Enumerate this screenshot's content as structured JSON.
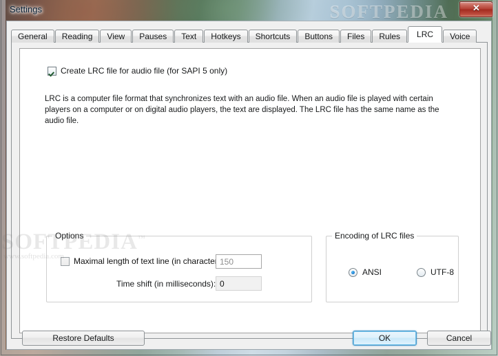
{
  "window": {
    "title": "Settings",
    "close_label": "✕",
    "close_icon": "close-icon"
  },
  "watermark": {
    "titlebar": "SOFTPEDIA",
    "body_main": "SOFTPEDIA",
    "body_tm": "™",
    "body_sub": "www.softpedia.com"
  },
  "tabs": [
    {
      "label": "General",
      "selected": false
    },
    {
      "label": "Reading",
      "selected": false
    },
    {
      "label": "View",
      "selected": false
    },
    {
      "label": "Pauses",
      "selected": false
    },
    {
      "label": "Text",
      "selected": false
    },
    {
      "label": "Hotkeys",
      "selected": false
    },
    {
      "label": "Shortcuts",
      "selected": false
    },
    {
      "label": "Buttons",
      "selected": false
    },
    {
      "label": "Files",
      "selected": false
    },
    {
      "label": "Rules",
      "selected": false
    },
    {
      "label": "LRC",
      "selected": true
    },
    {
      "label": "Voice",
      "selected": false
    }
  ],
  "lrc_page": {
    "create_lrc": {
      "label": "Create LRC file for audio file (for SAPI 5 only)",
      "checked": true
    },
    "description": "LRC is a computer file format that synchronizes text with an audio file. When an audio file is played with certain players on a computer or on digital audio players, the text are displayed. The LRC file has the same name as the audio file.",
    "options_group": {
      "title": "Options",
      "max_length": {
        "label": "Maximal length of text line (in characters):",
        "checked": false,
        "enabled": false,
        "value": "150"
      },
      "time_shift": {
        "label": "Time shift (in milliseconds):",
        "value": "0"
      }
    },
    "encoding_group": {
      "title": "Encoding of LRC files",
      "options": [
        {
          "label": "ANSI",
          "selected": true
        },
        {
          "label": "UTF-8",
          "selected": false
        }
      ]
    }
  },
  "footer": {
    "restore_defaults": "Restore Defaults",
    "ok": "OK",
    "cancel": "Cancel"
  },
  "colors": {
    "accent_default_button": "#4a97c9",
    "close_button": "#b44034",
    "dialog_face": "#f0f0f0",
    "panel": "#ffffff"
  }
}
